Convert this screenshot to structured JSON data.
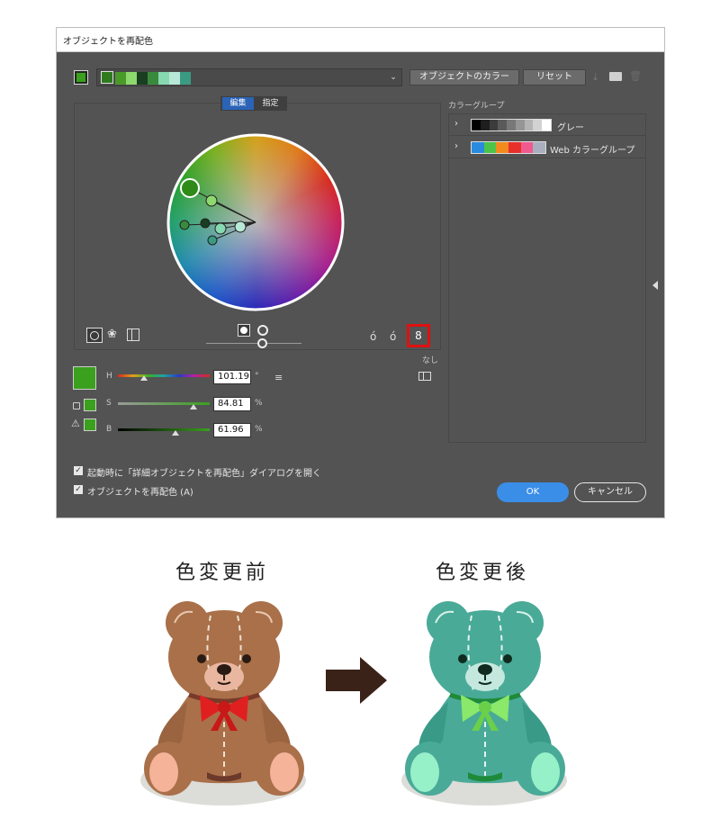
{
  "dialog": {
    "title": "オブジェクトを再配色",
    "color_strip": [
      "#4a9a2a",
      "#8ed96e",
      "#193e21",
      "#3a8a3e",
      "#86d9b0",
      "#b8e8d8",
      "#3a9a82"
    ],
    "current_color": "#3aa01e",
    "object_colors_button": "オブジェクトのカラー",
    "reset_button": "リセット",
    "tabs": {
      "edit": "編集",
      "assign": "指定"
    },
    "color_group_title": "カラーグループ",
    "groups": [
      {
        "label": "グレー",
        "swatches": [
          "#000000",
          "#1e1e1e",
          "#3c3c3c",
          "#5a5a5a",
          "#787878",
          "#969696",
          "#b4b4b4",
          "#d2d2d2",
          "#ffffff"
        ]
      },
      {
        "label": "Web カラーグループ",
        "swatches": [
          "#2a8ae0",
          "#4cc44a",
          "#f28a1e",
          "#e8302a",
          "#f05a8e",
          "#a8b0bf"
        ]
      }
    ],
    "link_status": "なし",
    "sliders": {
      "h": {
        "label": "H",
        "value": "101.19",
        "unit": "°"
      },
      "s": {
        "label": "S",
        "value": "84.81",
        "unit": "%"
      },
      "b": {
        "label": "B",
        "value": "61.96",
        "unit": "%"
      }
    },
    "checkbox_open_on_launch": "起動時に「詳細オブジェクトを再配色」ダイアログを開く",
    "checkbox_recolor": "オブジェクトを再配色 (A)",
    "ok_button": "OK",
    "cancel_button": "キャンセル"
  },
  "illustration": {
    "before_label": "色変更前",
    "after_label": "色変更後"
  }
}
